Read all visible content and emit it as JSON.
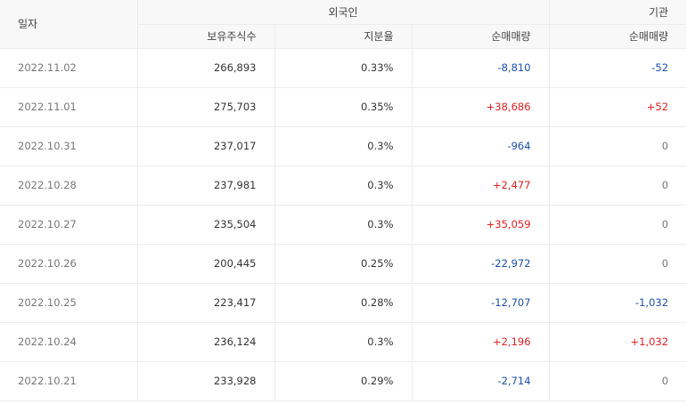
{
  "header": {
    "date_label": "일자",
    "foreign_group": "외국인",
    "institution_group": "기관",
    "holding_shares": "보유주식수",
    "share_ratio": "지분율",
    "foreign_net": "순매매량",
    "institution_net": "순매매량"
  },
  "colors": {
    "positive": "#e02020",
    "negative": "#1a4fb0",
    "zero": "#777777"
  },
  "rows": [
    {
      "date": "2022.11.02",
      "holding": "266,893",
      "ratio": "0.33%",
      "foreign_net": "-8,810",
      "inst_net": "-52"
    },
    {
      "date": "2022.11.01",
      "holding": "275,703",
      "ratio": "0.35%",
      "foreign_net": "+38,686",
      "inst_net": "+52"
    },
    {
      "date": "2022.10.31",
      "holding": "237,017",
      "ratio": "0.3%",
      "foreign_net": "-964",
      "inst_net": "0"
    },
    {
      "date": "2022.10.28",
      "holding": "237,981",
      "ratio": "0.3%",
      "foreign_net": "+2,477",
      "inst_net": "0"
    },
    {
      "date": "2022.10.27",
      "holding": "235,504",
      "ratio": "0.3%",
      "foreign_net": "+35,059",
      "inst_net": "0"
    },
    {
      "date": "2022.10.26",
      "holding": "200,445",
      "ratio": "0.25%",
      "foreign_net": "-22,972",
      "inst_net": "0"
    },
    {
      "date": "2022.10.25",
      "holding": "223,417",
      "ratio": "0.28%",
      "foreign_net": "-12,707",
      "inst_net": "-1,032"
    },
    {
      "date": "2022.10.24",
      "holding": "236,124",
      "ratio": "0.3%",
      "foreign_net": "+2,196",
      "inst_net": "+1,032"
    },
    {
      "date": "2022.10.21",
      "holding": "233,928",
      "ratio": "0.29%",
      "foreign_net": "-2,714",
      "inst_net": "0"
    }
  ]
}
